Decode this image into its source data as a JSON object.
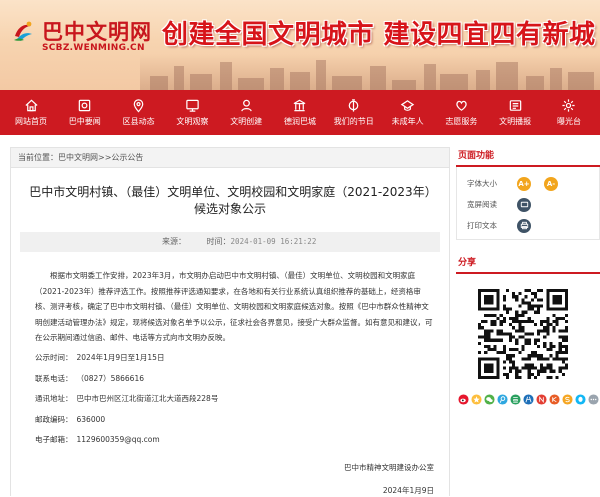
{
  "header": {
    "site_name": "巴中文明网",
    "site_url": "SCBZ.WENMING.CN",
    "slogan": "创建全国文明城市 建设四宜四有新城"
  },
  "nav": [
    {
      "label": "网站首页",
      "icon": "home-icon"
    },
    {
      "label": "巴中要闻",
      "icon": "news-icon"
    },
    {
      "label": "区县动态",
      "icon": "location-icon"
    },
    {
      "label": "文明观察",
      "icon": "eye-icon"
    },
    {
      "label": "文明创建",
      "icon": "building-icon"
    },
    {
      "label": "德润巴城",
      "icon": "flag-icon"
    },
    {
      "label": "我们的节日",
      "icon": "lantern-icon"
    },
    {
      "label": "未成年人",
      "icon": "child-icon"
    },
    {
      "label": "志愿服务",
      "icon": "heart-hands-icon"
    },
    {
      "label": "文明播报",
      "icon": "broadcast-icon"
    },
    {
      "label": "曝光台",
      "icon": "camera-icon"
    }
  ],
  "breadcrumb": {
    "prefix": "当前位置：",
    "home": "巴中文明网",
    "sep": ">>",
    "section": "公示公告"
  },
  "article": {
    "title": "巴中市文明村镇、（最佳）文明单位、文明校园和文明家庭（2021-2023年）候选对象公示",
    "source_label": "来源：",
    "time_label": "时间：",
    "time_value": "2024-01-09 16:21:22",
    "paragraph": "根据市文明委工作安排，2023年3月，市文明办启动巴中市文明村镇、（最佳）文明单位、文明校园和文明家庭（2021-2023年）推荐评选工作。按照推荐评选通知要求，在各地和有关行业系统认真组织推荐的基础上，经资格审核、测评考核，确定了巴中市文明村镇、（最佳）文明单位、文明校园和文明家庭候选对象。按照《巴中市群众性精神文明创建活动管理办法》规定，现将候选对象名单予以公示，征求社会各界意见，接受广大群众监督。如有意见和建议，可在公示期间通过信函、邮件、电话等方式向市文明办反映。",
    "info": [
      {
        "key": "公示时间：",
        "value": "2024年1月9日至1月15日"
      },
      {
        "key": "联系电话：",
        "value": "（0827）5866616"
      },
      {
        "key": "通讯地址：",
        "value": "巴中市巴州区江北街道江北大道西段228号"
      },
      {
        "key": "邮政编码：",
        "value": "636000"
      },
      {
        "key": "电子邮箱：",
        "value": "1129600359@qq.com"
      }
    ],
    "signature": "巴中市精神文明建设办公室",
    "sign_date": "2024年1月9日"
  },
  "sidebar": {
    "func_title": "页面功能",
    "font_label": "字体大小",
    "font_btn_large": "A+",
    "font_btn_small": "A-",
    "wide_label": "宽屏阅读",
    "print_label": "打印文本",
    "share_title": "分享"
  },
  "colors": {
    "brand_red": "#cd1a21",
    "accent_orange": "#f2a51d"
  }
}
